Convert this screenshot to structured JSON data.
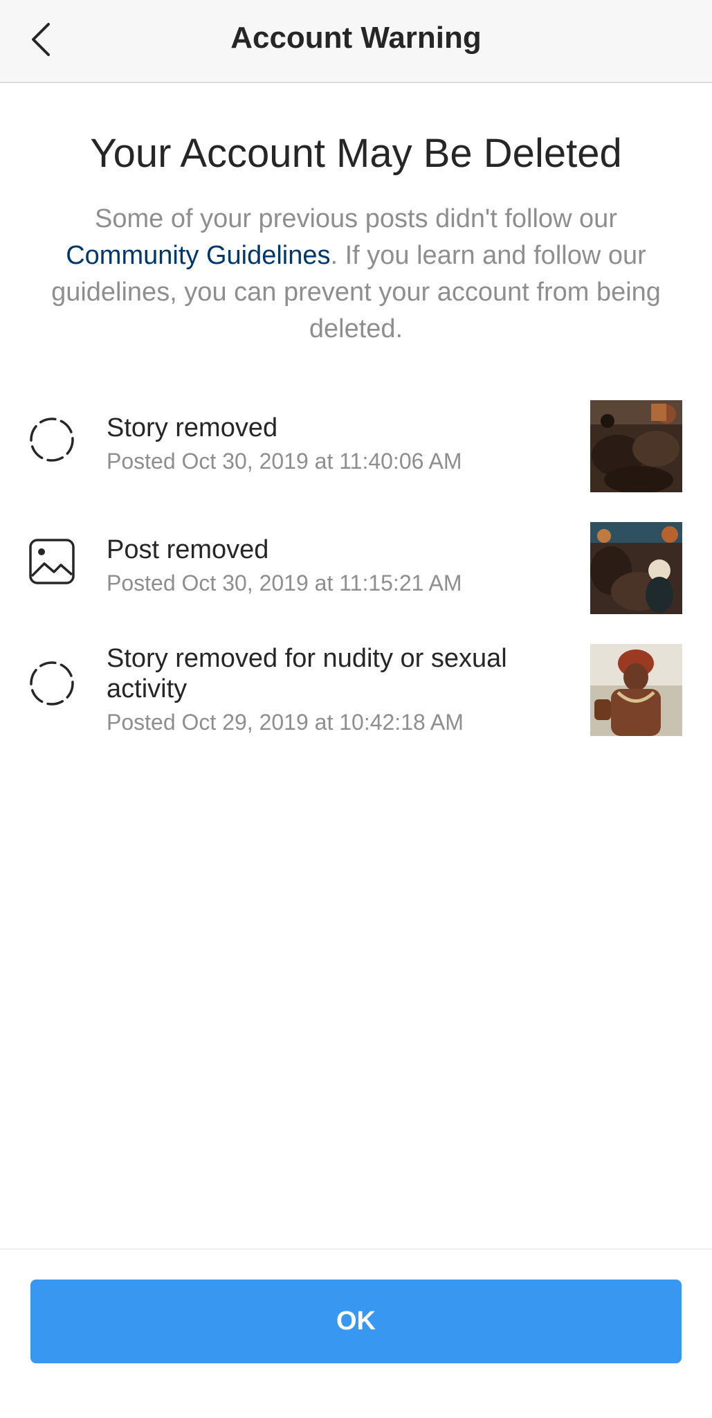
{
  "header": {
    "title": "Account Warning",
    "back_icon": "chevron-left-icon"
  },
  "main": {
    "title": "Your Account May Be Deleted",
    "description": {
      "part1": "Some of your previous posts didn't follow our ",
      "link": "Community Guidelines",
      "part2": ". If you learn and follow our guidelines, you can prevent your account from being deleted."
    }
  },
  "items": [
    {
      "icon": "story-dashed-circle-icon",
      "title": "Story removed",
      "subtitle": "Posted Oct 30, 2019 at 11:40:06 AM"
    },
    {
      "icon": "photo-icon",
      "title": "Post removed",
      "subtitle": "Posted Oct 30, 2019 at 11:15:21 AM"
    },
    {
      "icon": "story-dashed-circle-icon",
      "title": "Story removed for nudity or sexual activity",
      "subtitle": "Posted Oct 29, 2019 at 10:42:18 AM"
    }
  ],
  "footer": {
    "ok_label": "OK"
  },
  "colors": {
    "accent_button": "#3897f0",
    "link": "#00376b",
    "secondary_text": "#8e8e8e",
    "primary_text": "#262626"
  }
}
